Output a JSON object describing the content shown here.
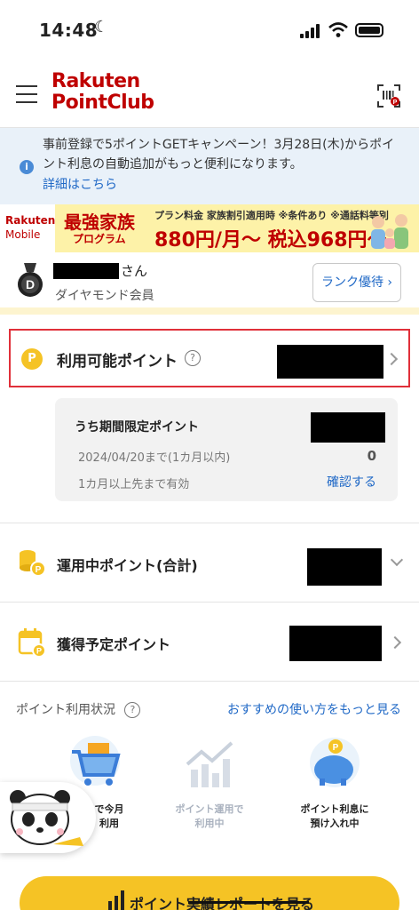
{
  "status_bar": {
    "time": "14:48"
  },
  "header": {
    "logo_line1": "Rakuten",
    "logo_line2": "PointClub"
  },
  "notice": {
    "message": "事前登録で5ポイントGETキャンペーン！3月28日(木)からポイント利息の自動追加がもっと便利になります。",
    "link": "詳細はこちら"
  },
  "banner": {
    "brand1": "Rakuten",
    "brand2": "Mobile",
    "title": "最強家族",
    "subtitle": "プログラム",
    "plan_line": "プラン料金 家族割引適用時 ※条件あり ※通話料等別",
    "price": "880円/月〜 税込968円〜"
  },
  "member": {
    "suffix": "さん",
    "rank": "ダイヤモンド会員",
    "rank_button": "ランク優待"
  },
  "available": {
    "badge": "P",
    "label": "利用可能ポイント",
    "help": "?"
  },
  "limited": {
    "title": "うち期間限定ポイント",
    "expiry": "2024/04/20まで(1カ月以内)",
    "expiry_value": "0",
    "valid": "1カ月以上先まで有効",
    "confirm": "確認する"
  },
  "rows": {
    "invest_label": "運用中ポイント(合計)",
    "pending_label": "獲得予定ポイント"
  },
  "usage": {
    "heading": "ポイント利用状況",
    "help": "?",
    "more_link": "おすすめの使い方をもっと見る",
    "item1_line1": "で今月",
    "item1_line2": "利用",
    "item2_line1": "ポイント運用で",
    "item2_line2": "利用中",
    "item3_line1": "ポイント利息に",
    "item3_line2": "預け入れ中"
  },
  "report_button": "ポイント実績レポートを見る",
  "colors": {
    "brand_red": "#bf0000",
    "accent_yellow": "#f5c325",
    "link_blue": "#1f68c6",
    "highlight_red": "#e0303a"
  }
}
